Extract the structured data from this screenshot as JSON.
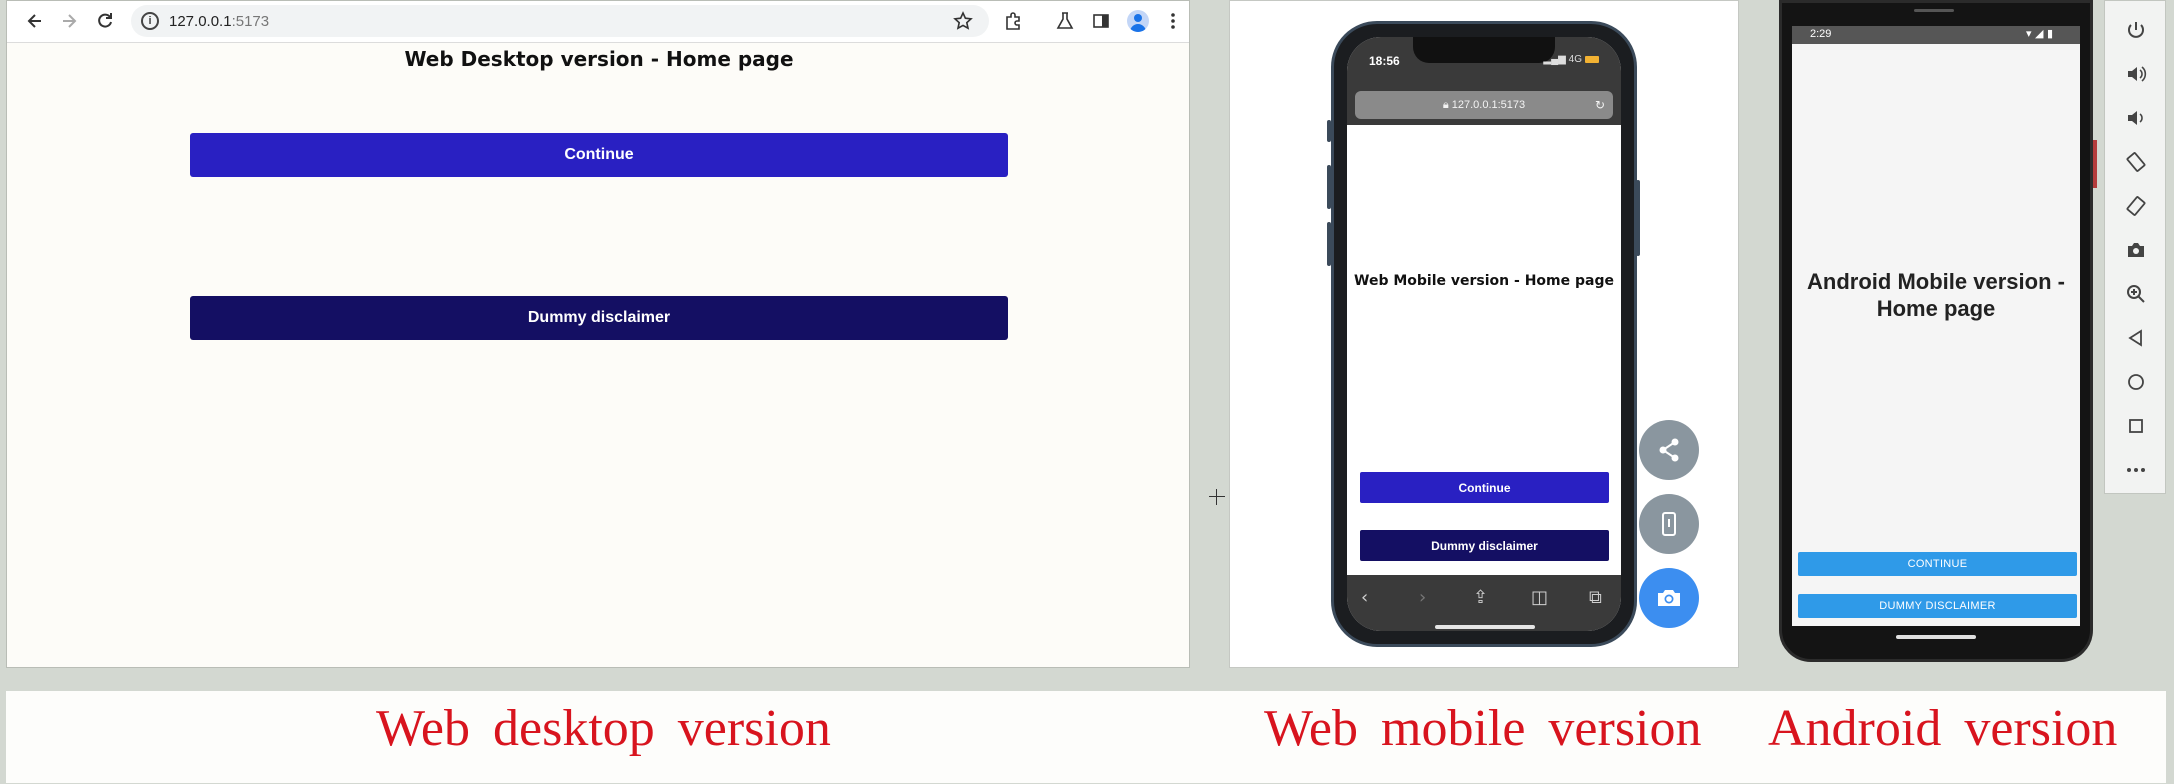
{
  "desktop": {
    "url_host": "127.0.0.1",
    "url_port": ":5173",
    "page_title": "Web Desktop version - Home page",
    "continue_label": "Continue",
    "disclaimer_label": "Dummy disclaimer"
  },
  "mobile": {
    "time": "18:56",
    "network": "4G",
    "url": "127.0.0.1:5173",
    "page_title": "Web Mobile version - Home page",
    "continue_label": "Continue",
    "disclaimer_label": "Dummy disclaimer"
  },
  "android": {
    "time": "2:29",
    "page_title": "Android Mobile version - Home page",
    "continue_label": "CONTINUE",
    "disclaimer_label": "DUMMY DISCLAIMER"
  },
  "captions": {
    "desktop": "Web desktop version",
    "mobile": "Web mobile version",
    "android": "Android version"
  },
  "colors": {
    "continue_button": "#2920c2",
    "disclaimer_button": "#140f63",
    "android_button": "#2f9ae8",
    "caption": "#d8141e",
    "camera_fab": "#3c8ef0"
  }
}
